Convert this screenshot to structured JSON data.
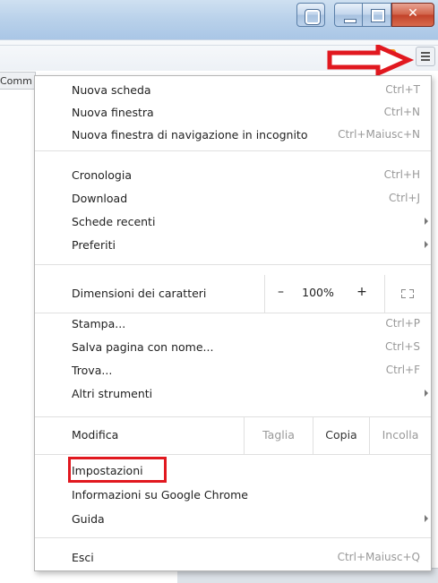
{
  "window": {
    "buttons": [
      "user",
      "minimize",
      "maximize",
      "close"
    ]
  },
  "toolbar": {
    "icons": [
      "star-icon",
      "rss-icon",
      "menu-icon"
    ]
  },
  "background": {
    "tab_text": "Comm"
  },
  "menu": {
    "group1": [
      {
        "label": "Nuova scheda",
        "shortcut": "Ctrl+T"
      },
      {
        "label": "Nuova finestra",
        "shortcut": "Ctrl+N"
      },
      {
        "label": "Nuova finestra di navigazione in incognito",
        "shortcut": "Ctrl+Maiusc+N"
      }
    ],
    "group2": [
      {
        "label": "Cronologia",
        "shortcut": "Ctrl+H"
      },
      {
        "label": "Download",
        "shortcut": "Ctrl+J"
      },
      {
        "label": "Schede recenti",
        "shortcut": ""
      },
      {
        "label": "Preferiti",
        "shortcut": ""
      }
    ],
    "zoom": {
      "label": "Dimensioni dei caratteri",
      "minus": "–",
      "level": "100%",
      "plus": "+"
    },
    "group3": [
      {
        "label": "Stampa...",
        "shortcut": "Ctrl+P"
      },
      {
        "label": "Salva pagina con nome...",
        "shortcut": "Ctrl+S"
      },
      {
        "label": "Trova...",
        "shortcut": "Ctrl+F"
      },
      {
        "label": "Altri strumenti",
        "shortcut": ""
      }
    ],
    "edit": {
      "label": "Modifica",
      "cut": "Taglia",
      "copy": "Copia",
      "paste": "Incolla"
    },
    "group4": [
      {
        "label": "Impostazioni"
      },
      {
        "label": "Informazioni su Google Chrome"
      },
      {
        "label": "Guida"
      }
    ],
    "exit": {
      "label": "Esci",
      "shortcut": "Ctrl+Maiusc+Q"
    }
  },
  "colors": {
    "highlight": "#e1181f",
    "shortcut_text": "#999999"
  }
}
